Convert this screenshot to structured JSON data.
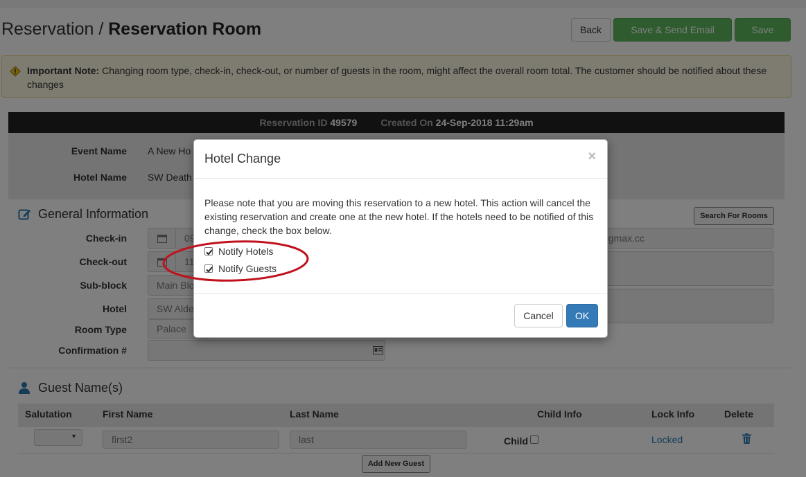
{
  "header": {
    "breadcrumb_parent": "Reservation / ",
    "title": "Reservation Room",
    "back_label": "Back",
    "save_send_label": "Save & Send Email",
    "save_label": "Save"
  },
  "alert": {
    "icon": "warning-icon",
    "strong": "Important Note:",
    "text": " Changing room type, check-in, check-out, or number of guests in the room, might affect the overall room total. The customer should be notified about these changes"
  },
  "infobar": {
    "reservation_id_label": "Reservation ID",
    "reservation_id": "49579",
    "created_label": "Created On",
    "created_value": "24-Sep-2018 11:29am"
  },
  "event": {
    "event_name_label": "Event Name",
    "event_name_value": "A New Ho",
    "hotel_name_label": "Hotel Name",
    "hotel_name_value": "SW Death"
  },
  "general": {
    "title": "General Information",
    "icon": "edit-icon",
    "search_rooms_label": "Search For Rooms",
    "checkin_label": "Check-in",
    "checkin_value": "09",
    "checkout_label": "Check-out",
    "checkout_value": "11",
    "subblock_label": "Sub-block",
    "subblock_value": "Main Blo",
    "hotel_label": "Hotel",
    "hotel_value": "SW Alde",
    "roomtype_label": "Room Type",
    "roomtype_value": "Palace",
    "confirmation_label": "Confirmation #",
    "email_value": "tingmax.cc"
  },
  "guests": {
    "title": "Guest Name(s)",
    "icon": "user-icon",
    "columns": [
      "Salutation",
      "First Name",
      "Last Name",
      "Child Info",
      "Lock Info",
      "Delete"
    ],
    "rows": [
      {
        "first_name": "first2",
        "last_name": "last",
        "child_label": "Child",
        "lock": "Locked"
      }
    ],
    "add_label": "Add New Guest"
  },
  "modal": {
    "title": "Hotel Change",
    "close": "×",
    "body": "Please note that you are moving this reservation to a new hotel. This action will cancel the existing reservation and create one at the new hotel. If the hotels need to be notified of this change, check the box below.",
    "notify_hotels_label": "Notify Hotels",
    "notify_hotels_checked": true,
    "notify_guests_label": "Notify Guests",
    "notify_guests_checked": true,
    "cancel_label": "Cancel",
    "ok_label": "OK"
  },
  "colors": {
    "success": "#5cb85c",
    "primary": "#337ab7",
    "alert_bg": "#fcf8e3",
    "annotation": "#c0121e"
  }
}
